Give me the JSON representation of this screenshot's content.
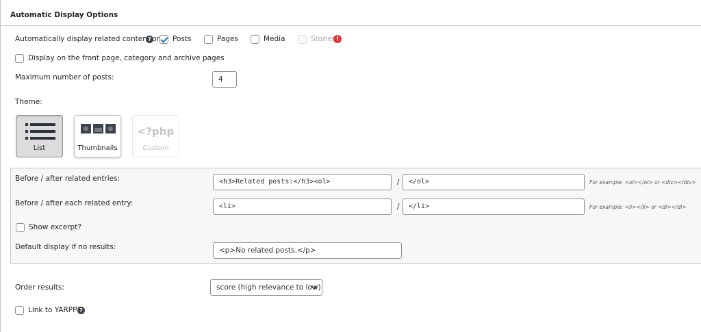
{
  "panel": {
    "title": "Automatic Display Options"
  },
  "display_on": {
    "label": "Automatically display related content on:",
    "options": [
      {
        "label": "Posts",
        "checked": true,
        "enabled": true
      },
      {
        "label": "Pages",
        "checked": false,
        "enabled": true
      },
      {
        "label": "Media",
        "checked": false,
        "enabled": true
      },
      {
        "label": "Stories",
        "checked": false,
        "enabled": false
      }
    ],
    "help_icon": "question-mark-icon",
    "warning_icon": "exclamation-icon"
  },
  "front_page": {
    "label": "Display on the front page, category and archive pages",
    "checked": false
  },
  "max_posts": {
    "label": "Maximum number of posts:",
    "value": "4"
  },
  "theme": {
    "label": "Theme:",
    "options": [
      {
        "label": "List",
        "icon": "list-icon",
        "selected": true
      },
      {
        "label": "Thumbnails",
        "icon": "thumbnails-icon",
        "selected": false
      },
      {
        "label": "Custom",
        "icon": "php-icon",
        "icon_text": "<?php",
        "disabled": true
      }
    ]
  },
  "entries": {
    "before_after_label": "Before / after related entries:",
    "before_value": "<h3>Related posts:</h3><ol>",
    "after_value": "</ol>",
    "separator": "/",
    "hint": "For example: <ol></ol> or <div></div>"
  },
  "entry": {
    "before_after_label": "Before / after each related entry:",
    "before_value": "<li>",
    "after_value": "</li>",
    "separator": "/",
    "hint": "For example: <li></li> or <dl></dl>"
  },
  "excerpt": {
    "label": "Show excerpt?",
    "checked": false
  },
  "no_results": {
    "label": "Default display if no results:",
    "value": "<p>No related posts.</p>"
  },
  "order": {
    "label": "Order results:",
    "value": "score (high relevance to low)"
  },
  "link_yarpp": {
    "label": "Link to YARPP?",
    "checked": false
  },
  "colors": {
    "accent": "#2271b1",
    "warning": "#d63638",
    "border": "#c3c4c7"
  }
}
